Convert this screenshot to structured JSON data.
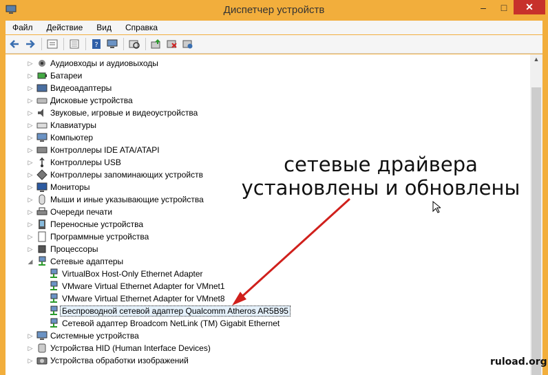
{
  "window": {
    "title": "Диспетчер устройств",
    "minimize": "–",
    "maximize": "□",
    "close": "✕"
  },
  "menu": [
    "Файл",
    "Действие",
    "Вид",
    "Справка"
  ],
  "toolbar_icons": [
    "back-icon",
    "forward-icon",
    "properties-icon",
    "list-icon",
    "help-icon",
    "monitor-icon",
    "update-driver-icon",
    "disable-icon",
    "uninstall-icon"
  ],
  "tree": [
    {
      "label": "Аудиовходы и аудиовыходы",
      "icon": "audio-icon",
      "expanded": false,
      "level": 0
    },
    {
      "label": "Батареи",
      "icon": "battery-icon",
      "expanded": false,
      "level": 0
    },
    {
      "label": "Видеоадаптеры",
      "icon": "display-adapter-icon",
      "expanded": false,
      "level": 0
    },
    {
      "label": "Дисковые устройства",
      "icon": "disk-icon",
      "expanded": false,
      "level": 0
    },
    {
      "label": "Звуковые, игровые и видеоустройства",
      "icon": "sound-icon",
      "expanded": false,
      "level": 0
    },
    {
      "label": "Клавиатуры",
      "icon": "keyboard-icon",
      "expanded": false,
      "level": 0
    },
    {
      "label": "Компьютер",
      "icon": "computer-icon",
      "expanded": false,
      "level": 0
    },
    {
      "label": "Контроллеры IDE ATA/ATAPI",
      "icon": "ide-icon",
      "expanded": false,
      "level": 0
    },
    {
      "label": "Контроллеры USB",
      "icon": "usb-icon",
      "expanded": false,
      "level": 0
    },
    {
      "label": "Контроллеры запоминающих устройств",
      "icon": "storage-icon",
      "expanded": false,
      "level": 0
    },
    {
      "label": "Мониторы",
      "icon": "monitor-icon",
      "expanded": false,
      "level": 0
    },
    {
      "label": "Мыши и иные указывающие устройства",
      "icon": "mouse-icon",
      "expanded": false,
      "level": 0
    },
    {
      "label": "Очереди печати",
      "icon": "printer-icon",
      "expanded": false,
      "level": 0
    },
    {
      "label": "Переносные устройства",
      "icon": "portable-icon",
      "expanded": false,
      "level": 0
    },
    {
      "label": "Программные устройства",
      "icon": "software-icon",
      "expanded": false,
      "level": 0
    },
    {
      "label": "Процессоры",
      "icon": "cpu-icon",
      "expanded": false,
      "level": 0
    },
    {
      "label": "Сетевые адаптеры",
      "icon": "network-icon",
      "expanded": true,
      "level": 0
    },
    {
      "label": "VirtualBox Host-Only Ethernet Adapter",
      "icon": "network-icon",
      "level": 1
    },
    {
      "label": "VMware Virtual Ethernet Adapter for VMnet1",
      "icon": "network-icon",
      "level": 1
    },
    {
      "label": "VMware Virtual Ethernet Adapter for VMnet8",
      "icon": "network-icon",
      "level": 1
    },
    {
      "label": "Беспроводной сетевой адаптер Qualcomm Atheros AR5B95",
      "icon": "network-icon",
      "level": 1,
      "selected": true
    },
    {
      "label": "Сетевой адаптер Broadcom NetLink (TM) Gigabit Ethernet",
      "icon": "network-icon",
      "level": 1
    },
    {
      "label": "Системные устройства",
      "icon": "system-icon",
      "expanded": false,
      "level": 0
    },
    {
      "label": "Устройства HID (Human Interface Devices)",
      "icon": "hid-icon",
      "expanded": false,
      "level": 0
    },
    {
      "label": "Устройства обработки изображений",
      "icon": "camera-icon",
      "expanded": false,
      "level": 0
    }
  ],
  "annotation": {
    "line1": "сетевые драйвера",
    "line2": "установлены и обновлены"
  },
  "watermark": "ruload.org",
  "colors": {
    "frame": "#f2ae3c",
    "close": "#c7312b",
    "arrow": "#d0201c"
  }
}
